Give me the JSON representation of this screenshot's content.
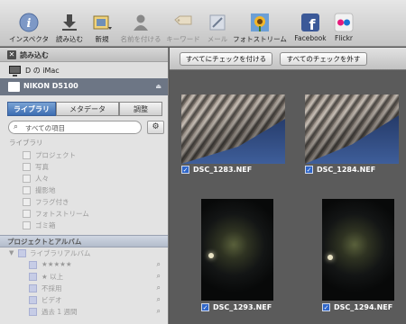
{
  "toolbar": {
    "items": [
      {
        "label": "インスペクタ",
        "icon": "info-icon"
      },
      {
        "label": "読み込む",
        "icon": "import-arrow-icon"
      },
      {
        "label": "新規",
        "icon": "new-folder-icon"
      },
      {
        "label": "名前を付ける",
        "icon": "person-icon"
      },
      {
        "label": "キーワード",
        "icon": "tag-icon"
      },
      {
        "label": "メール",
        "icon": "mail-icon"
      },
      {
        "label": "フォトストリーム",
        "icon": "sunflower-icon"
      },
      {
        "label": "Facebook",
        "icon": "facebook-icon"
      },
      {
        "label": "Flickr",
        "icon": "flickr-icon"
      }
    ]
  },
  "sidebar": {
    "import_header": "読み込む",
    "devices": [
      "D の iMac",
      "NIKON D5100"
    ],
    "tabs": [
      "ライブラリ",
      "メタデータ",
      "調整"
    ],
    "search_placeholder": "すべての項目",
    "library_section": "ライブラリ",
    "library_items": [
      "プロジェクト",
      "写真",
      "人々",
      "撮影地",
      "フラグ付き",
      "フォトストリーム",
      "ゴミ箱"
    ],
    "projects_header": "プロジェクトとアルバム",
    "library_album": "ライブラリアルバム",
    "album_items": [
      "★★★★★",
      "★ 以上",
      "不採用",
      "ビデオ",
      "過去 1 週間"
    ]
  },
  "browser": {
    "check_all": "すべてにチェックを付ける",
    "uncheck_all": "すべてのチェックを外す",
    "photos": [
      {
        "name": "DSC_1283.NEF",
        "checked": true
      },
      {
        "name": "DSC_1284.NEF",
        "checked": true
      },
      {
        "name": "DSC_1293.NEF",
        "checked": true
      },
      {
        "name": "DSC_1294.NEF",
        "checked": true
      }
    ]
  }
}
